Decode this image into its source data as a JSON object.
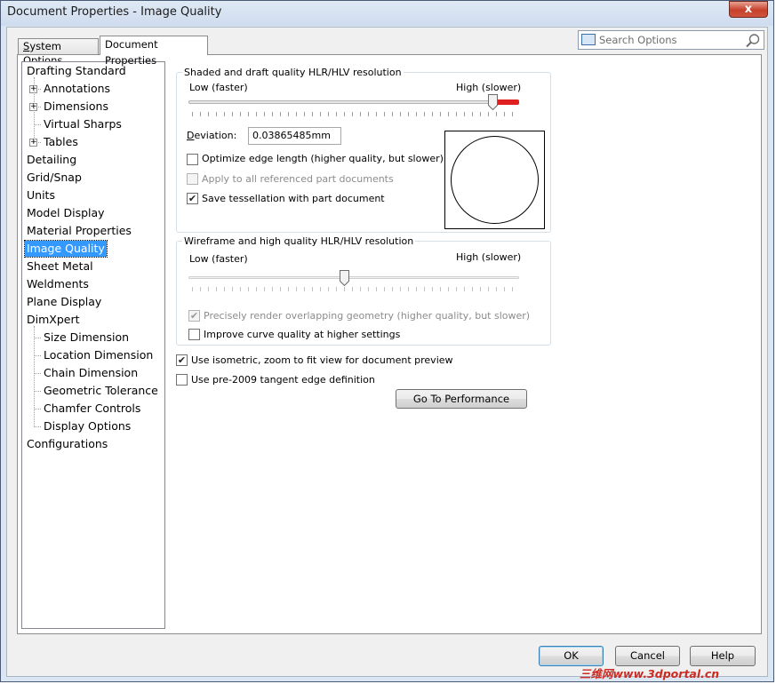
{
  "window": {
    "title": "Document Properties - Image Quality",
    "close_glyph": "x"
  },
  "tabs": [
    {
      "label": "System Options"
    },
    {
      "label": "Document Properties"
    }
  ],
  "search": {
    "placeholder": "Search Options"
  },
  "tree": {
    "items": [
      {
        "label": "Drafting Standard"
      },
      {
        "label": "Annotations"
      },
      {
        "label": "Dimensions"
      },
      {
        "label": "Virtual Sharps"
      },
      {
        "label": "Tables"
      },
      {
        "label": "Detailing"
      },
      {
        "label": "Grid/Snap"
      },
      {
        "label": "Units"
      },
      {
        "label": "Model Display"
      },
      {
        "label": "Material Properties"
      },
      {
        "label": "Image Quality"
      },
      {
        "label": "Sheet Metal"
      },
      {
        "label": "Weldments"
      },
      {
        "label": "Plane Display"
      },
      {
        "label": "DimXpert"
      },
      {
        "label": "Size Dimension"
      },
      {
        "label": "Location Dimension"
      },
      {
        "label": "Chain Dimension"
      },
      {
        "label": "Geometric Tolerance"
      },
      {
        "label": "Chamfer Controls"
      },
      {
        "label": "Display Options"
      },
      {
        "label": "Configurations"
      }
    ],
    "selected": "Image Quality"
  },
  "shaded": {
    "title": "Shaded and draft quality HLR/HLV resolution",
    "low_label": "Low (faster)",
    "high_label": "High (slower)",
    "slider_level": 0.92,
    "deviation_label": "Deviation:",
    "deviation_value": "0.03865485mm",
    "optimize_label": "Optimize edge length (higher quality, but slower)",
    "optimize_checked": false,
    "apply_all_label": "Apply to all referenced part documents",
    "apply_all_checked": false,
    "save_tess_label": "Save tessellation with part document",
    "save_tess_checked": true
  },
  "wireframe": {
    "title": "Wireframe and high quality HLR/HLV resolution",
    "low_label": "Low (faster)",
    "high_label": "High (slower)",
    "slider_level": 0.47,
    "precise_label": "Precisely render overlapping geometry (higher quality, but slower)",
    "precise_checked": true,
    "improve_label": "Improve curve quality at higher settings",
    "improve_checked": false
  },
  "isometric": {
    "label": "Use isometric, zoom to fit view for document preview",
    "checked": true
  },
  "pre2009": {
    "label": "Use pre-2009 tangent edge definition",
    "checked": false
  },
  "buttons": {
    "performance": "Go To Performance",
    "ok": "OK",
    "cancel": "Cancel",
    "help": "Help"
  },
  "watermark": "三维网www.3dportal.cn",
  "colors": {
    "selection": "#3399ff",
    "slider_active": "#e02020"
  }
}
